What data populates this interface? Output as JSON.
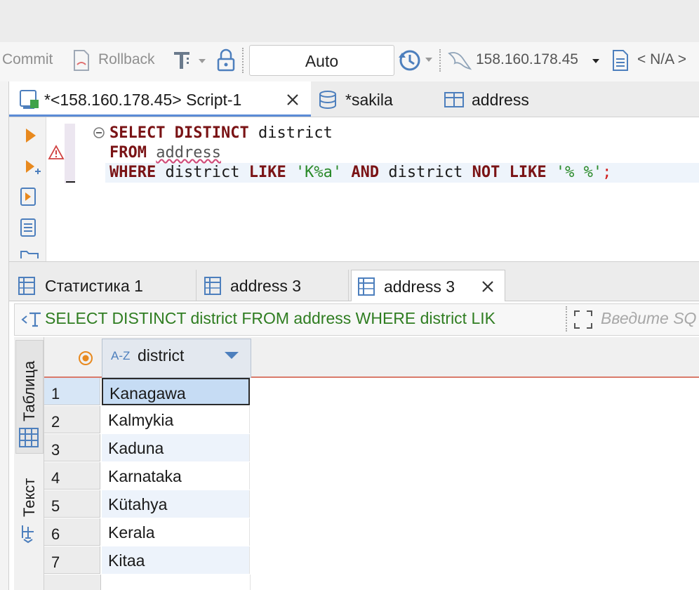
{
  "toolbar": {
    "commit_label": "Commit",
    "rollback_label": "Rollback",
    "mode_value": "Auto",
    "connection_label": "158.160.178.45",
    "schema_label": "< N/A >"
  },
  "editor_tabs": [
    {
      "label": "*<158.160.178.45> Script-1"
    },
    {
      "label": "*sakila"
    },
    {
      "label": "address"
    }
  ],
  "sql": {
    "line1": {
      "kw1": "SELECT",
      "kw2": "DISTINCT",
      "col": "district"
    },
    "line2": {
      "kw": "FROM",
      "table": "address"
    },
    "line3": {
      "kw_where": "WHERE",
      "col1": "district",
      "kw_like": "LIKE",
      "pattern1": "'K%a'",
      "kw_and": "AND",
      "col2": "district",
      "kw_not": "NOT",
      "kw_like2": "LIKE",
      "pattern2": "'% %'",
      "semicolon": ";"
    }
  },
  "result_tabs": [
    {
      "label": "Статистика 1"
    },
    {
      "label": "address 3"
    },
    {
      "label": "address 3"
    }
  ],
  "query_bar": {
    "query_text": "SELECT DISTINCT district FROM address WHERE district LIK",
    "filter_placeholder": "Введите SQ"
  },
  "side_tabs": {
    "table_label": "Таблица",
    "text_label": "Текст"
  },
  "grid": {
    "column_type": "A-Z",
    "column_header": "district",
    "rows": [
      {
        "n": "1",
        "district": "Kanagawa"
      },
      {
        "n": "2",
        "district": "Kalmykia"
      },
      {
        "n": "3",
        "district": "Kaduna"
      },
      {
        "n": "4",
        "district": "Karnataka"
      },
      {
        "n": "5",
        "district": "Kütahya"
      },
      {
        "n": "6",
        "district": "Kerala"
      },
      {
        "n": "7",
        "district": "Kitaa"
      }
    ]
  },
  "colors": {
    "accent": "#5b8bd6",
    "keyword": "#7a1315",
    "string": "#2a8a2a",
    "query": "#2f7d21",
    "selected": "#c6dcf4"
  }
}
